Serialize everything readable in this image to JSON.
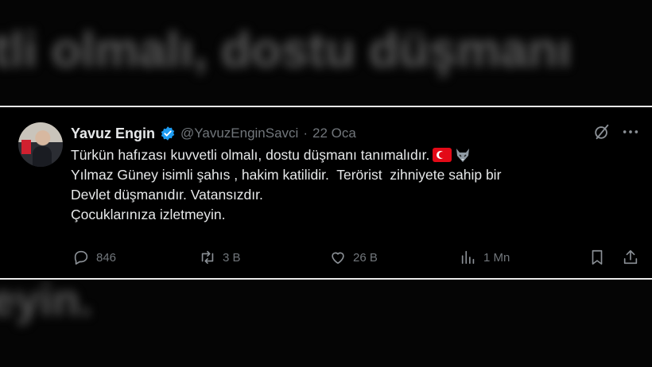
{
  "background": {
    "top_text": "...",
    "middle_text": "tli olmalı, dostu düşmanı",
    "bottom_text": "eyin."
  },
  "tweet": {
    "author_name": "Yavuz Engin",
    "handle": "@YavuzEnginSavci",
    "separator": "·",
    "date": "22 Oca",
    "lines": [
      "Türkün hafızası kuvvetli olmalı, dostu düşmanı tanımalıdır.",
      "Yılmaz Güney isimli şahıs , hakim katilidir.  Terörist  zihniyete sahip bir",
      "Devlet düşmanıdır. Vatansızdır.",
      "Çocuklarınıza izletmeyin."
    ],
    "emojis": [
      "turkey-flag",
      "wolf"
    ],
    "stats": {
      "replies": "846",
      "retweets": "3 B",
      "likes": "26 B",
      "views": "1 Mn"
    }
  },
  "colors": {
    "text": "#e7e9ea",
    "muted": "#71767b",
    "verified": "#1d9bf0",
    "background": "#000000"
  }
}
